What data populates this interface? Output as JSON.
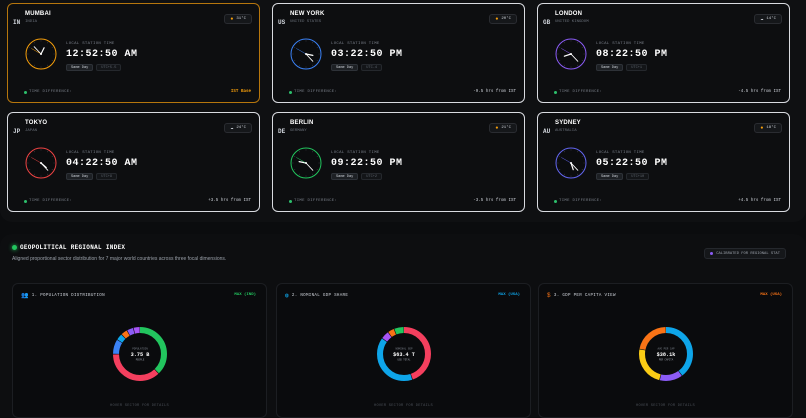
{
  "cities": [
    {
      "code": "IN",
      "name": "MUMBAI",
      "country": "INDIA",
      "temp": "31°C",
      "weather_icon": "sun-icon",
      "weather_color": "#f59e0b",
      "label": "LOCAL STATION TIME",
      "time": "12:52:50 AM",
      "day": "Same Day",
      "utc": "UTC+5.5",
      "diff_label": "TIME DIFFERENCE:",
      "diff": "IST Base",
      "accent": "#f59e0b",
      "border": "#f59e0b",
      "hands": {
        "hour": 12.88,
        "minute": 52.8,
        "second": 50
      }
    },
    {
      "code": "US",
      "name": "NEW YORK",
      "country": "UNITED STATES",
      "temp": "20°C",
      "weather_icon": "sun-icon",
      "weather_color": "#f59e0b",
      "label": "LOCAL STATION TIME",
      "time": "03:22:50 PM",
      "day": "Same Day",
      "utc": "UTC-4",
      "diff_label": "TIME DIFFERENCE:",
      "diff": "-9.5 hrs from IST",
      "accent": "#3b82f6",
      "border": "#e6e6e6",
      "hands": {
        "hour": 3.38,
        "minute": 22.8,
        "second": 50
      }
    },
    {
      "code": "GB",
      "name": "LONDON",
      "country": "UNITED KINGDOM",
      "temp": "14°C",
      "weather_icon": "cloud-icon",
      "weather_color": "#cfd3da",
      "label": "LOCAL STATION TIME",
      "time": "08:22:50 PM",
      "day": "Same Day",
      "utc": "UTC+1",
      "diff_label": "TIME DIFFERENCE:",
      "diff": "-4.5 hrs from IST",
      "accent": "#8b5cf6",
      "border": "#e6e6e6",
      "hands": {
        "hour": 8.38,
        "minute": 22.8,
        "second": 50
      }
    },
    {
      "code": "JP",
      "name": "TOKYO",
      "country": "JAPAN",
      "temp": "24°C",
      "weather_icon": "cloud-icon",
      "weather_color": "#cfd3da",
      "label": "LOCAL STATION TIME",
      "time": "04:22:50 AM",
      "day": "Same Day",
      "utc": "UTC+9",
      "diff_label": "TIME DIFFERENCE:",
      "diff": "+3.5 hrs from IST",
      "accent": "#ef4444",
      "border": "#e6e6e6",
      "hands": {
        "hour": 4.38,
        "minute": 22.8,
        "second": 50
      }
    },
    {
      "code": "DE",
      "name": "BERLIN",
      "country": "GERMANY",
      "temp": "21°C",
      "weather_icon": "sun-icon",
      "weather_color": "#f59e0b",
      "label": "LOCAL STATION TIME",
      "time": "09:22:50 PM",
      "day": "Same Day",
      "utc": "UTC+2",
      "diff_label": "TIME DIFFERENCE:",
      "diff": "-3.5 hrs from IST",
      "accent": "#22c55e",
      "border": "#e6e6e6",
      "hands": {
        "hour": 9.38,
        "minute": 22.8,
        "second": 50
      }
    },
    {
      "code": "AU",
      "name": "SYDNEY",
      "country": "AUSTRALIA",
      "temp": "18°C",
      "weather_icon": "sun-icon",
      "weather_color": "#f59e0b",
      "label": "LOCAL STATION TIME",
      "time": "05:22:50 PM",
      "day": "Same Day",
      "utc": "UTC+10",
      "diff_label": "TIME DIFFERENCE:",
      "diff": "+4.5 hrs from IST",
      "accent": "#6366f1",
      "border": "#e6e6e6",
      "hands": {
        "hour": 5.38,
        "minute": 22.8,
        "second": 50
      }
    }
  ],
  "section": {
    "title": "GEOPOLITICAL REGIONAL INDEX",
    "subtitle": "Aligned proportional sector distribution for 7 major world countries across three focal dimensions.",
    "calibrate": "CALIBRATED FOR REGIONAL STAT"
  },
  "panels": [
    {
      "icon": "people-icon",
      "icon_color": "#22c55e",
      "title": "1. POPULATION DISTRIBUTION",
      "max": "MAX (IND)",
      "max_color": "#22c55e",
      "center_label": "POPULATION",
      "center_value": "3.75 B",
      "center_unit": "PEOPLE",
      "hover": "HOVER SECTOR FOR DETAILS",
      "segments": [
        {
          "color": "#22c55e",
          "value": 38
        },
        {
          "color": "#f43f5e",
          "value": 37
        },
        {
          "color": "#3b82f6",
          "value": 9
        },
        {
          "color": "#0ea5e9",
          "value": 4
        },
        {
          "color": "#f97316",
          "value": 4
        },
        {
          "color": "#8b5cf6",
          "value": 4
        },
        {
          "color": "#a855f7",
          "value": 4
        }
      ]
    },
    {
      "icon": "globe-icon",
      "icon_color": "#0ea5e9",
      "title": "2. NOMINAL GDP SHARE",
      "max": "MAX (USA)",
      "max_color": "#0ea5e9",
      "center_label": "NOMINAL GDP",
      "center_value": "$63.4 T",
      "center_unit": "USD TOTAL",
      "hover": "HOVER SECTOR FOR DETAILS",
      "segments": [
        {
          "color": "#f43f5e",
          "value": 45
        },
        {
          "color": "#0ea5e9",
          "value": 40
        },
        {
          "color": "#a855f7",
          "value": 5
        },
        {
          "color": "#f97316",
          "value": 4
        },
        {
          "color": "#22c55e",
          "value": 6
        }
      ]
    },
    {
      "icon": "dollar-icon",
      "icon_color": "#f97316",
      "title": "3. GDP PER CAPITA VIEW",
      "max": "MAX (USA)",
      "max_color": "#f97316",
      "center_label": "AVG PER CAP",
      "center_value": "$38.1k",
      "center_unit": "PER CAPITA",
      "hover": "HOVER SECTOR FOR DETAILS",
      "segments": [
        {
          "color": "#0ea5e9",
          "value": 40
        },
        {
          "color": "#8b5cf6",
          "value": 14
        },
        {
          "color": "#facc15",
          "value": 24
        },
        {
          "color": "#f97316",
          "value": 22
        }
      ]
    }
  ]
}
